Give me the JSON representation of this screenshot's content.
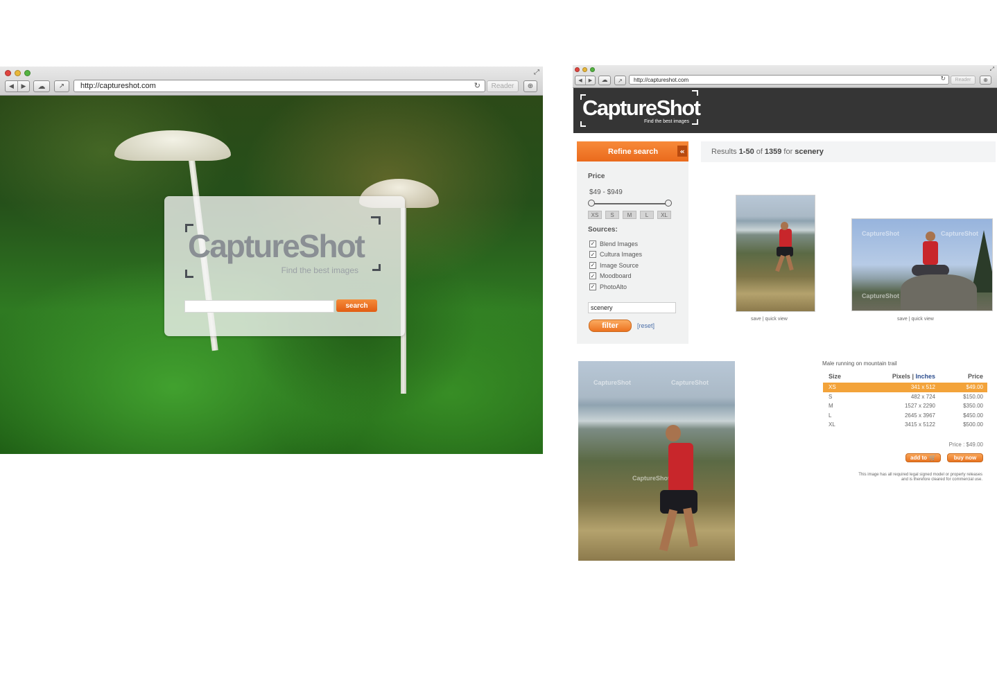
{
  "left_browser": {
    "url": "http://captureshot.com",
    "reader_label": "Reader",
    "logo_text": "CaptureShot",
    "logo_tagline": "Find the best images",
    "search_value": "",
    "search_button": "search"
  },
  "right_browser": {
    "url": "http://captureshot.com",
    "reader_label": "Reader",
    "logo_text": "CaptureShot",
    "logo_tagline": "Find the best images",
    "sidebar": {
      "refine_title": "Refine search",
      "collapse_glyph": "«",
      "price_label": "Price",
      "price_range": "$49 - $949",
      "sizes": [
        "XS",
        "S",
        "M",
        "L",
        "XL"
      ],
      "sources_label": "Sources:",
      "sources": [
        "Blend Images",
        "Cultura Images",
        "Image Source",
        "Moodboard",
        "PhotoAlto"
      ],
      "filter_value": "scenery",
      "filter_button": "filter",
      "reset_link": "[reset]"
    },
    "results": {
      "prefix": "Results",
      "range": "1-50",
      "of_word": "of",
      "total": "1359",
      "for_word": "for",
      "query": "scenery"
    },
    "thumb_links": {
      "save": "save",
      "separator": "|",
      "quick_view": "quick view"
    },
    "watermark": "CaptureShot",
    "detail": {
      "title": "Male running on mountain trail",
      "headers": {
        "size": "Size",
        "pixels": "Pixels",
        "sep": "|",
        "inches": "Inches",
        "price": "Price"
      },
      "rows": [
        {
          "size": "XS",
          "pixels": "341 x 512",
          "price": "$49.00"
        },
        {
          "size": "S",
          "pixels": "482 x 724",
          "price": "$150.00"
        },
        {
          "size": "M",
          "pixels": "1527 x 2290",
          "price": "$350.00"
        },
        {
          "size": "L",
          "pixels": "2645 x 3967",
          "price": "$450.00"
        },
        {
          "size": "XL",
          "pixels": "3415 x 5122",
          "price": "$500.00"
        }
      ],
      "price_line": "Price : $49.00",
      "add_to_button": "add to",
      "buy_now_button": "buy now",
      "legal_line1": "This image has all required legal signed model or property releases",
      "legal_line2": "and is therefore cleared for commercial use."
    }
  },
  "colors": {
    "accent_orange": "#ea6a1c",
    "header_dark": "#353535",
    "link_blue": "#2e4f8f"
  }
}
